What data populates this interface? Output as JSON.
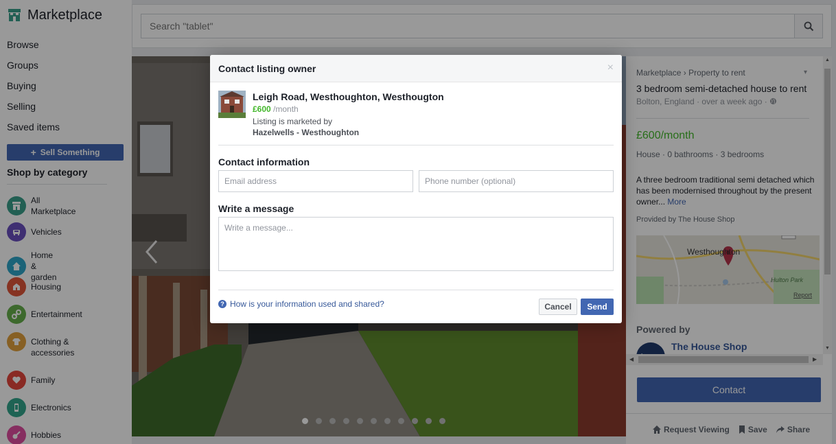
{
  "sidebar": {
    "brand": "Marketplace",
    "nav": [
      "Browse",
      "Groups",
      "Buying",
      "Selling",
      "Saved items"
    ],
    "sell_button": "Sell Something",
    "shop_heading": "Shop by category",
    "categories": [
      {
        "label": "All Marketplace",
        "color": "#3a9e8a",
        "icon": "store-icon"
      },
      {
        "label": "Vehicles",
        "color": "#6a4fbf",
        "icon": "car-icon"
      },
      {
        "label": "Home & garden",
        "color": "#2ea5c9",
        "icon": "home-icon"
      },
      {
        "label": "Housing",
        "color": "#e0553a",
        "icon": "house-icon"
      },
      {
        "label": "Entertainment",
        "color": "#67b04b",
        "icon": "link-icon"
      },
      {
        "label": "Clothing & accessories",
        "color": "#e2a13d",
        "icon": "clothing-icon"
      },
      {
        "label": "Family",
        "color": "#e5473c",
        "icon": "heart-icon"
      },
      {
        "label": "Electronics",
        "color": "#33a68c",
        "icon": "phone-icon"
      },
      {
        "label": "Hobbies",
        "color": "#e04ea0",
        "icon": "guitar-icon"
      }
    ]
  },
  "search": {
    "placeholder": "Search \"tablet\""
  },
  "detail": {
    "breadcrumb": [
      "Marketplace",
      "Property to rent"
    ],
    "title": "3 bedroom semi-detached house to rent",
    "location_meta": "Bolton, England · over a week ago ·",
    "price": "£600/month",
    "specs": "House · 0 bathrooms · 3 bedrooms",
    "description": "A three bedroom traditional semi detached which has been modernised throughout by the present owner...",
    "more_link": "More",
    "provided_by": "Provided by The House Shop",
    "map": {
      "town": "Westhoughton",
      "park": "Hulton Park",
      "report": "Report"
    },
    "powered_by": "Powered by",
    "provider_name": "The House Shop",
    "contact_button": "Contact",
    "actions": [
      "Request Viewing",
      "Save",
      "Share"
    ]
  },
  "photo": {
    "dot_count": 11,
    "active_dot": 0
  },
  "modal": {
    "title": "Contact listing owner",
    "close": "×",
    "listing": {
      "address": "Leigh Road, Westhoughton, Westhougton",
      "price_amount": "£600",
      "price_period": " /month",
      "marketed_by_label": "Listing is marketed by",
      "agent": "Hazelwells - Westhoughton"
    },
    "contact_heading": "Contact information",
    "email_placeholder": "Email address",
    "phone_placeholder": "Phone number (optional)",
    "message_heading": "Write a message",
    "message_placeholder": "Write a message...",
    "help_link": "How is your information used and shared?",
    "cancel": "Cancel",
    "send": "Send"
  }
}
